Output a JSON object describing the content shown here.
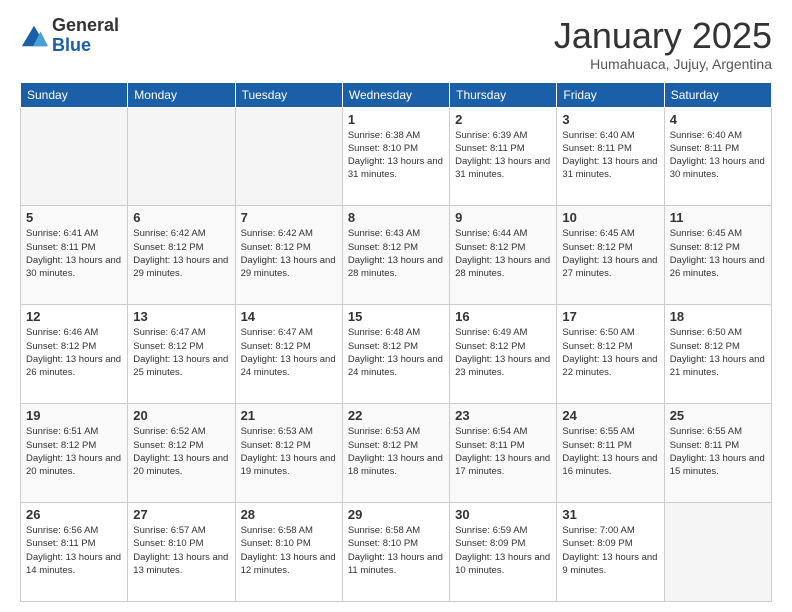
{
  "logo": {
    "general": "General",
    "blue": "Blue"
  },
  "header": {
    "title": "January 2025",
    "subtitle": "Humahuaca, Jujuy, Argentina"
  },
  "columns": [
    "Sunday",
    "Monday",
    "Tuesday",
    "Wednesday",
    "Thursday",
    "Friday",
    "Saturday"
  ],
  "weeks": [
    [
      {
        "day": "",
        "info": ""
      },
      {
        "day": "",
        "info": ""
      },
      {
        "day": "",
        "info": ""
      },
      {
        "day": "1",
        "info": "Sunrise: 6:38 AM\nSunset: 8:10 PM\nDaylight: 13 hours and 31 minutes."
      },
      {
        "day": "2",
        "info": "Sunrise: 6:39 AM\nSunset: 8:11 PM\nDaylight: 13 hours and 31 minutes."
      },
      {
        "day": "3",
        "info": "Sunrise: 6:40 AM\nSunset: 8:11 PM\nDaylight: 13 hours and 31 minutes."
      },
      {
        "day": "4",
        "info": "Sunrise: 6:40 AM\nSunset: 8:11 PM\nDaylight: 13 hours and 30 minutes."
      }
    ],
    [
      {
        "day": "5",
        "info": "Sunrise: 6:41 AM\nSunset: 8:11 PM\nDaylight: 13 hours and 30 minutes."
      },
      {
        "day": "6",
        "info": "Sunrise: 6:42 AM\nSunset: 8:12 PM\nDaylight: 13 hours and 29 minutes."
      },
      {
        "day": "7",
        "info": "Sunrise: 6:42 AM\nSunset: 8:12 PM\nDaylight: 13 hours and 29 minutes."
      },
      {
        "day": "8",
        "info": "Sunrise: 6:43 AM\nSunset: 8:12 PM\nDaylight: 13 hours and 28 minutes."
      },
      {
        "day": "9",
        "info": "Sunrise: 6:44 AM\nSunset: 8:12 PM\nDaylight: 13 hours and 28 minutes."
      },
      {
        "day": "10",
        "info": "Sunrise: 6:45 AM\nSunset: 8:12 PM\nDaylight: 13 hours and 27 minutes."
      },
      {
        "day": "11",
        "info": "Sunrise: 6:45 AM\nSunset: 8:12 PM\nDaylight: 13 hours and 26 minutes."
      }
    ],
    [
      {
        "day": "12",
        "info": "Sunrise: 6:46 AM\nSunset: 8:12 PM\nDaylight: 13 hours and 26 minutes."
      },
      {
        "day": "13",
        "info": "Sunrise: 6:47 AM\nSunset: 8:12 PM\nDaylight: 13 hours and 25 minutes."
      },
      {
        "day": "14",
        "info": "Sunrise: 6:47 AM\nSunset: 8:12 PM\nDaylight: 13 hours and 24 minutes."
      },
      {
        "day": "15",
        "info": "Sunrise: 6:48 AM\nSunset: 8:12 PM\nDaylight: 13 hours and 24 minutes."
      },
      {
        "day": "16",
        "info": "Sunrise: 6:49 AM\nSunset: 8:12 PM\nDaylight: 13 hours and 23 minutes."
      },
      {
        "day": "17",
        "info": "Sunrise: 6:50 AM\nSunset: 8:12 PM\nDaylight: 13 hours and 22 minutes."
      },
      {
        "day": "18",
        "info": "Sunrise: 6:50 AM\nSunset: 8:12 PM\nDaylight: 13 hours and 21 minutes."
      }
    ],
    [
      {
        "day": "19",
        "info": "Sunrise: 6:51 AM\nSunset: 8:12 PM\nDaylight: 13 hours and 20 minutes."
      },
      {
        "day": "20",
        "info": "Sunrise: 6:52 AM\nSunset: 8:12 PM\nDaylight: 13 hours and 20 minutes."
      },
      {
        "day": "21",
        "info": "Sunrise: 6:53 AM\nSunset: 8:12 PM\nDaylight: 13 hours and 19 minutes."
      },
      {
        "day": "22",
        "info": "Sunrise: 6:53 AM\nSunset: 8:12 PM\nDaylight: 13 hours and 18 minutes."
      },
      {
        "day": "23",
        "info": "Sunrise: 6:54 AM\nSunset: 8:11 PM\nDaylight: 13 hours and 17 minutes."
      },
      {
        "day": "24",
        "info": "Sunrise: 6:55 AM\nSunset: 8:11 PM\nDaylight: 13 hours and 16 minutes."
      },
      {
        "day": "25",
        "info": "Sunrise: 6:55 AM\nSunset: 8:11 PM\nDaylight: 13 hours and 15 minutes."
      }
    ],
    [
      {
        "day": "26",
        "info": "Sunrise: 6:56 AM\nSunset: 8:11 PM\nDaylight: 13 hours and 14 minutes."
      },
      {
        "day": "27",
        "info": "Sunrise: 6:57 AM\nSunset: 8:10 PM\nDaylight: 13 hours and 13 minutes."
      },
      {
        "day": "28",
        "info": "Sunrise: 6:58 AM\nSunset: 8:10 PM\nDaylight: 13 hours and 12 minutes."
      },
      {
        "day": "29",
        "info": "Sunrise: 6:58 AM\nSunset: 8:10 PM\nDaylight: 13 hours and 11 minutes."
      },
      {
        "day": "30",
        "info": "Sunrise: 6:59 AM\nSunset: 8:09 PM\nDaylight: 13 hours and 10 minutes."
      },
      {
        "day": "31",
        "info": "Sunrise: 7:00 AM\nSunset: 8:09 PM\nDaylight: 13 hours and 9 minutes."
      },
      {
        "day": "",
        "info": ""
      }
    ]
  ]
}
